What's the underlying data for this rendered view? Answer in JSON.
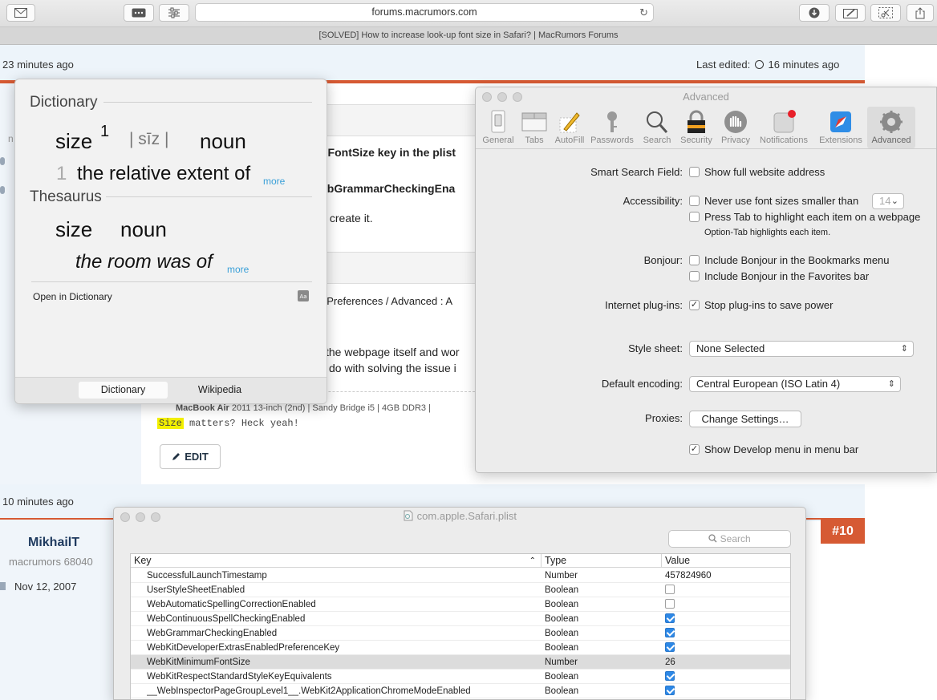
{
  "browser": {
    "url": "forums.macrumors.com",
    "tab_title": "[SOLVED] How to increase look-up font size in Safari? | MacRumors Forums"
  },
  "forum": {
    "post1_time": "23 minutes ago",
    "last_edited_label": "Last edited:",
    "last_edited_time": "16 minutes ago",
    "frag_fontsize": "nFontSize key in the plist",
    "frag_grammar": "ebGrammarCheckingEna",
    "frag_create": "y create it.",
    "frag_prefs": "/ Preferences / Advanced : A",
    "frag_webpage": "the webpage itself and wor",
    "frag_solving": "do with solving the issue i",
    "sig_model": "MacBook Air",
    "sig_details": "2011 13-inch (2nd) | Sandy Bridge i5 | 4GB DDR3 |",
    "code_highlight": "Size",
    "code_rest": " matters? Heck yeah!",
    "edit_label": "EDIT",
    "post2_time": "10 minutes ago",
    "username": "MikhailT",
    "user_title": "macrumors 68040",
    "join_date": "Nov 12, 2007",
    "post_number": "#10",
    "side_frag_n": "n"
  },
  "dictionary": {
    "section1": "Dictionary",
    "word": "size",
    "superscript": "1",
    "pron": "| sīz |",
    "pos": "noun",
    "def_num": "1",
    "definition": "the relative extent of",
    "more1": "more",
    "section2": "Thesaurus",
    "th_word": "size",
    "th_pos": "noun",
    "th_example": "the room was of",
    "more2": "more",
    "open_link": "Open in Dictionary",
    "tab_dictionary": "Dictionary",
    "tab_wikipedia": "Wikipedia"
  },
  "prefs": {
    "title": "Advanced",
    "tabs": [
      "General",
      "Tabs",
      "AutoFill",
      "Passwords",
      "Search",
      "Security",
      "Privacy",
      "Notifications",
      "Extensions",
      "Advanced"
    ],
    "smart_search_label": "Smart Search Field:",
    "smart_search_opt": "Show full website address",
    "accessibility_label": "Accessibility:",
    "min_font_opt": "Never use font sizes smaller than",
    "min_font_value": "14",
    "tab_highlight_opt": "Press Tab to highlight each item on a webpage",
    "tab_highlight_note": "Option-Tab highlights each item.",
    "bonjour_label": "Bonjour:",
    "bonjour_bookmarks": "Include Bonjour in the Bookmarks menu",
    "bonjour_favorites": "Include Bonjour in the Favorites bar",
    "plugins_label": "Internet plug-ins:",
    "plugins_opt": "Stop plug-ins to save power",
    "stylesheet_label": "Style sheet:",
    "stylesheet_value": "None Selected",
    "encoding_label": "Default encoding:",
    "encoding_value": "Central European (ISO Latin 4)",
    "proxies_label": "Proxies:",
    "proxies_button": "Change Settings…",
    "develop_opt": "Show Develop menu in menu bar",
    "check": "✓"
  },
  "plist": {
    "title": "com.apple.Safari.plist",
    "search_placeholder": "Search",
    "headers": {
      "key": "Key",
      "type": "Type",
      "value": "Value"
    },
    "rows": [
      {
        "key": "SuccessfulLaunchTimestamp",
        "type": "Number",
        "value": "457824960",
        "checked": null
      },
      {
        "key": "UserStyleSheetEnabled",
        "type": "Boolean",
        "value": "",
        "checked": false
      },
      {
        "key": "WebAutomaticSpellingCorrectionEnabled",
        "type": "Boolean",
        "value": "",
        "checked": false
      },
      {
        "key": "WebContinuousSpellCheckingEnabled",
        "type": "Boolean",
        "value": "",
        "checked": true
      },
      {
        "key": "WebGrammarCheckingEnabled",
        "type": "Boolean",
        "value": "",
        "checked": true
      },
      {
        "key": "WebKitDeveloperExtrasEnabledPreferenceKey",
        "type": "Boolean",
        "value": "",
        "checked": true
      },
      {
        "key": "WebKitMinimumFontSize",
        "type": "Number",
        "value": "26",
        "checked": null
      },
      {
        "key": "WebKitRespectStandardStyleKeyEquivalents",
        "type": "Boolean",
        "value": "",
        "checked": true
      },
      {
        "key": "__WebInspectorPageGroupLevel1__.WebKit2ApplicationChromeModeEnabled",
        "type": "Boolean",
        "value": "",
        "checked": true
      }
    ]
  }
}
